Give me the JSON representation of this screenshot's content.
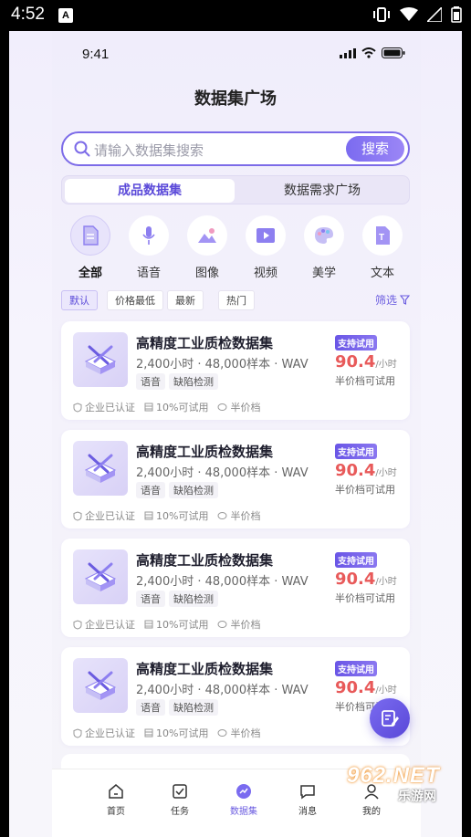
{
  "system_bar": {
    "time": "4:52",
    "notification_letter": "A"
  },
  "inner_status": {
    "time": "9:41"
  },
  "page": {
    "title": "数据集广场"
  },
  "search": {
    "placeholder": "请输入数据集搜索",
    "button_label": "搜索"
  },
  "segment": {
    "tabs": [
      "成品数据集",
      "数据需求广场"
    ],
    "active_index": 0
  },
  "categories": [
    {
      "label": "全部",
      "icon": "document-icon",
      "active": true
    },
    {
      "label": "语音",
      "icon": "microphone-icon",
      "active": false
    },
    {
      "label": "图像",
      "icon": "image-icon",
      "active": false
    },
    {
      "label": "视频",
      "icon": "video-icon",
      "active": false
    },
    {
      "label": "美学",
      "icon": "palette-icon",
      "active": false
    },
    {
      "label": "文本",
      "icon": "text-file-icon",
      "active": false
    }
  ],
  "filters": {
    "chips": [
      "默认",
      "价格最低",
      "最新",
      "热门"
    ],
    "active_index": 0,
    "filter_label": "筛选"
  },
  "datasets": [
    {
      "title": "高精度工业质检数据集",
      "meta": "2,400小时 · 48,000样本 · WAV",
      "tags": [
        "语音",
        "缺陷检测"
      ],
      "badge": "支持试用",
      "price": "90.4",
      "unit": "/小时",
      "half_price_note": "半价档可试用",
      "footer": [
        "企业已认证",
        "10%可试用",
        "半价档"
      ]
    },
    {
      "title": "高精度工业质检数据集",
      "meta": "2,400小时 · 48,000样本 · WAV",
      "tags": [
        "语音",
        "缺陷检测"
      ],
      "badge": "支持试用",
      "price": "90.4",
      "unit": "/小时",
      "half_price_note": "半价档可试用",
      "footer": [
        "企业已认证",
        "10%可试用",
        "半价档"
      ]
    },
    {
      "title": "高精度工业质检数据集",
      "meta": "2,400小时 · 48,000样本 · WAV",
      "tags": [
        "语音",
        "缺陷检测"
      ],
      "badge": "支持试用",
      "price": "90.4",
      "unit": "/小时",
      "half_price_note": "半价档可试用",
      "footer": [
        "企业已认证",
        "10%可试用",
        "半价档"
      ]
    },
    {
      "title": "高精度工业质检数据集",
      "meta": "2,400小时 · 48,000样本 · WAV",
      "tags": [
        "语音",
        "缺陷检测"
      ],
      "badge": "支持试用",
      "price": "90.4",
      "unit": "/小时",
      "half_price_note": "半价档可试用",
      "footer": [
        "企业已认证",
        "10%可试用",
        "半价档"
      ]
    }
  ],
  "tabbar": {
    "items": [
      {
        "label": "首页",
        "icon": "home-icon"
      },
      {
        "label": "任务",
        "icon": "task-icon"
      },
      {
        "label": "数据集",
        "icon": "dataset-icon"
      },
      {
        "label": "消息",
        "icon": "message-icon"
      },
      {
        "label": "我的",
        "icon": "user-icon"
      }
    ],
    "active_index": 2
  },
  "watermark": {
    "brand": "962.NET",
    "sub": "乐游网"
  },
  "colors": {
    "accent": "#6b5ce0",
    "price": "#e85a5a",
    "background": "#f1eefc"
  }
}
